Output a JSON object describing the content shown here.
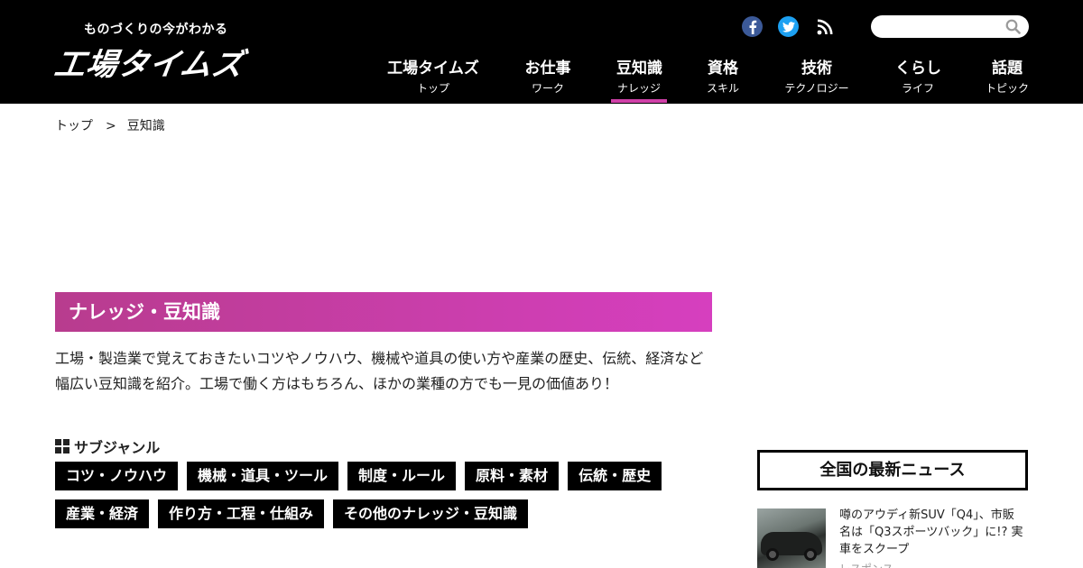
{
  "header": {
    "tagline": "ものづくりの今がわかる",
    "logo": "工場タイムズ",
    "search": {
      "placeholder": ""
    },
    "social": [
      "facebook-icon",
      "twitter-icon",
      "rss-icon"
    ],
    "nav": [
      {
        "label": "工場タイムズ",
        "sub": "トップ",
        "active": false
      },
      {
        "label": "お仕事",
        "sub": "ワーク",
        "active": false
      },
      {
        "label": "豆知識",
        "sub": "ナレッジ",
        "active": true
      },
      {
        "label": "資格",
        "sub": "スキル",
        "active": false
      },
      {
        "label": "技術",
        "sub": "テクノロジー",
        "active": false
      },
      {
        "label": "くらし",
        "sub": "ライフ",
        "active": false
      },
      {
        "label": "話題",
        "sub": "トピック",
        "active": false
      }
    ]
  },
  "breadcrumb": {
    "home": "トップ",
    "separator": ">",
    "current": "豆知識"
  },
  "main": {
    "heading": "ナレッジ・豆知識",
    "description_lines": [
      "工場・製造業で覚えておきたいコツやノウハウ、機械や道具の使い方や産業の歴史、伝統、経済など",
      "幅広い豆知識を紹介。工場で働く方はもちろん、ほかの業種の方でも一見の価値あり！"
    ],
    "subgenre_title": "サブジャンル",
    "tags_row1": [
      "コツ・ノウハウ",
      "機械・道具・ツール",
      "制度・ルール",
      "原料・素材",
      "伝統・歴史"
    ],
    "tags_row2": [
      "産業・経済",
      "作り方・工程・仕組み",
      "その他のナレッジ・豆知識"
    ]
  },
  "sidebar": {
    "news_title": "全国の最新ニュース",
    "news_item": {
      "lines": [
        "噂のアウディ新SUV「Q4」、市販",
        "名は「Q3スポーツバック」に!? 実",
        "車をスクープ"
      ],
      "source": "レスポンス"
    }
  },
  "colors": {
    "header_bg": "#000000",
    "accent": "#d040a8",
    "heading_gradient_start": "#b83c8e",
    "heading_gradient_end": "#d63fbf",
    "tag_bg": "#000000"
  }
}
